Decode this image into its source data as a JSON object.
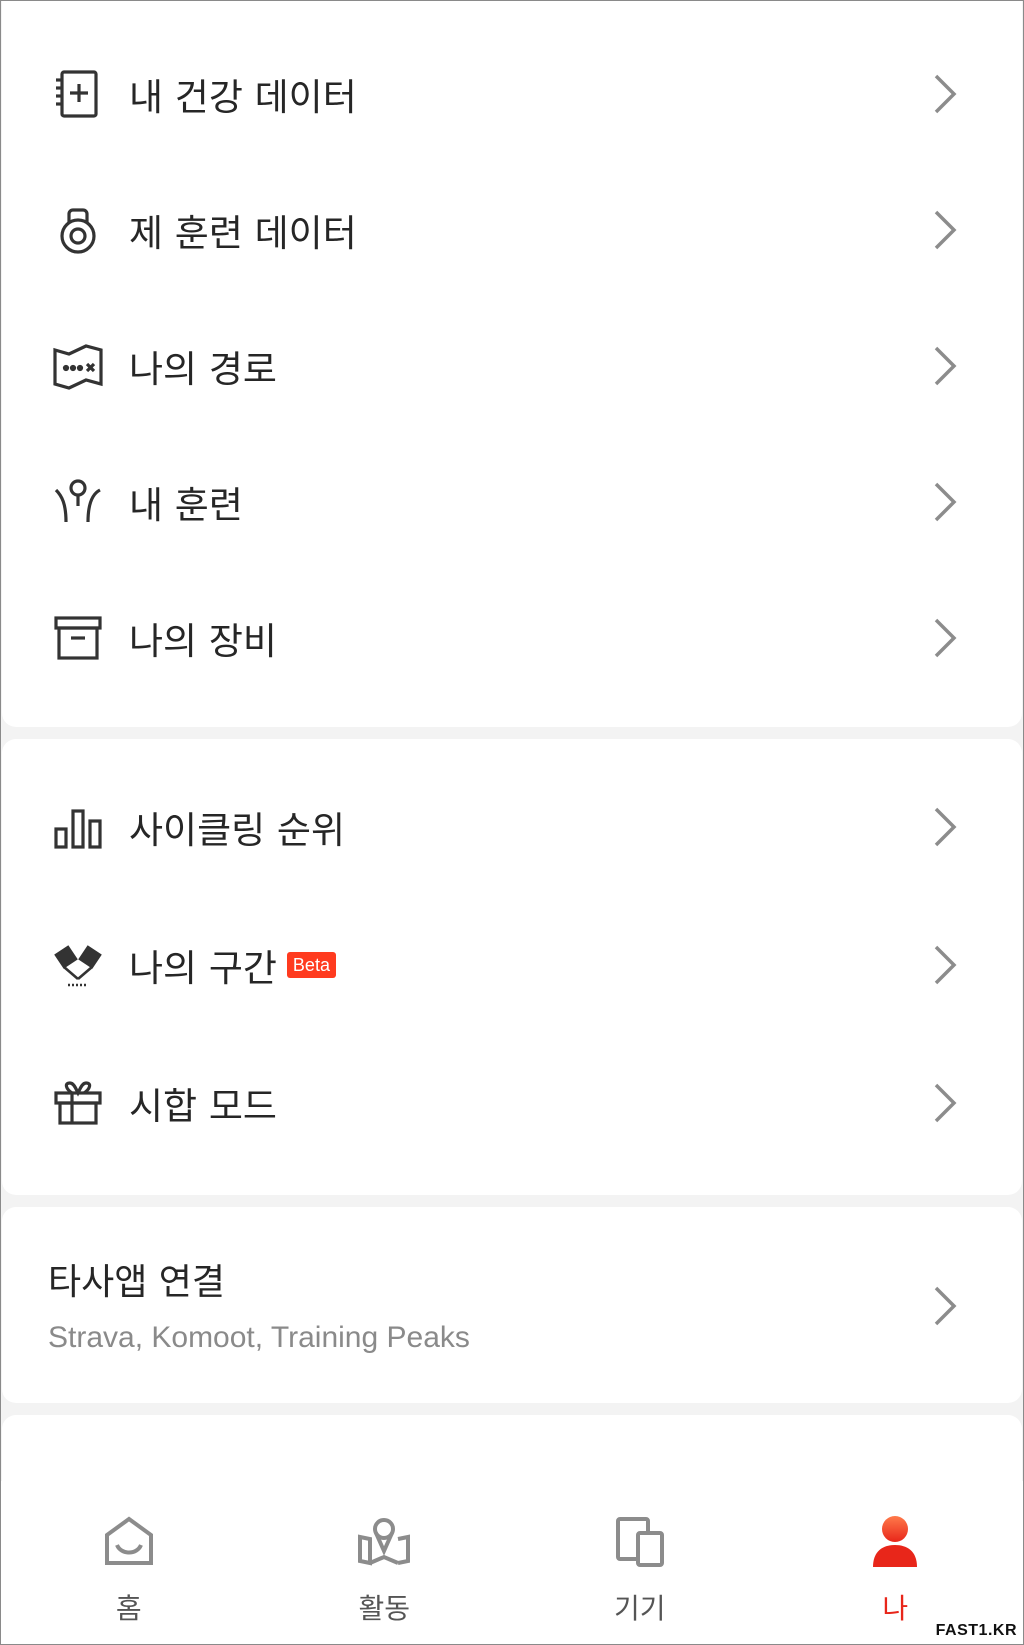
{
  "menu_group_1": [
    {
      "label": "내 건강 데이터",
      "icon": "health-data-icon"
    },
    {
      "label": "제 훈련 데이터",
      "icon": "kettlebell-icon"
    },
    {
      "label": "나의 경로",
      "icon": "route-map-icon"
    },
    {
      "label": "내 훈련",
      "icon": "training-icon"
    },
    {
      "label": "나의 장비",
      "icon": "equipment-box-icon"
    }
  ],
  "menu_group_2": [
    {
      "label": "사이클링 순위",
      "icon": "ranking-bars-icon"
    },
    {
      "label": "나의 구간",
      "icon": "segment-flags-icon",
      "badge": "Beta"
    },
    {
      "label": "시합 모드",
      "icon": "race-gift-icon"
    }
  ],
  "third_party": {
    "title": "타사앱 연결",
    "subtitle": "Strava, Komoot, Training Peaks"
  },
  "bottom_nav": [
    {
      "label": "홈",
      "icon": "home-icon",
      "active": false
    },
    {
      "label": "활동",
      "icon": "activity-map-icon",
      "active": false
    },
    {
      "label": "기기",
      "icon": "devices-icon",
      "active": false
    },
    {
      "label": "나",
      "icon": "profile-icon",
      "active": true
    }
  ],
  "watermark": "FAST1.KR",
  "colors": {
    "accent": "#e8261a",
    "beta_badge": "#ff3b1f",
    "chevron": "#8c8c8c",
    "icon": "#333333"
  }
}
